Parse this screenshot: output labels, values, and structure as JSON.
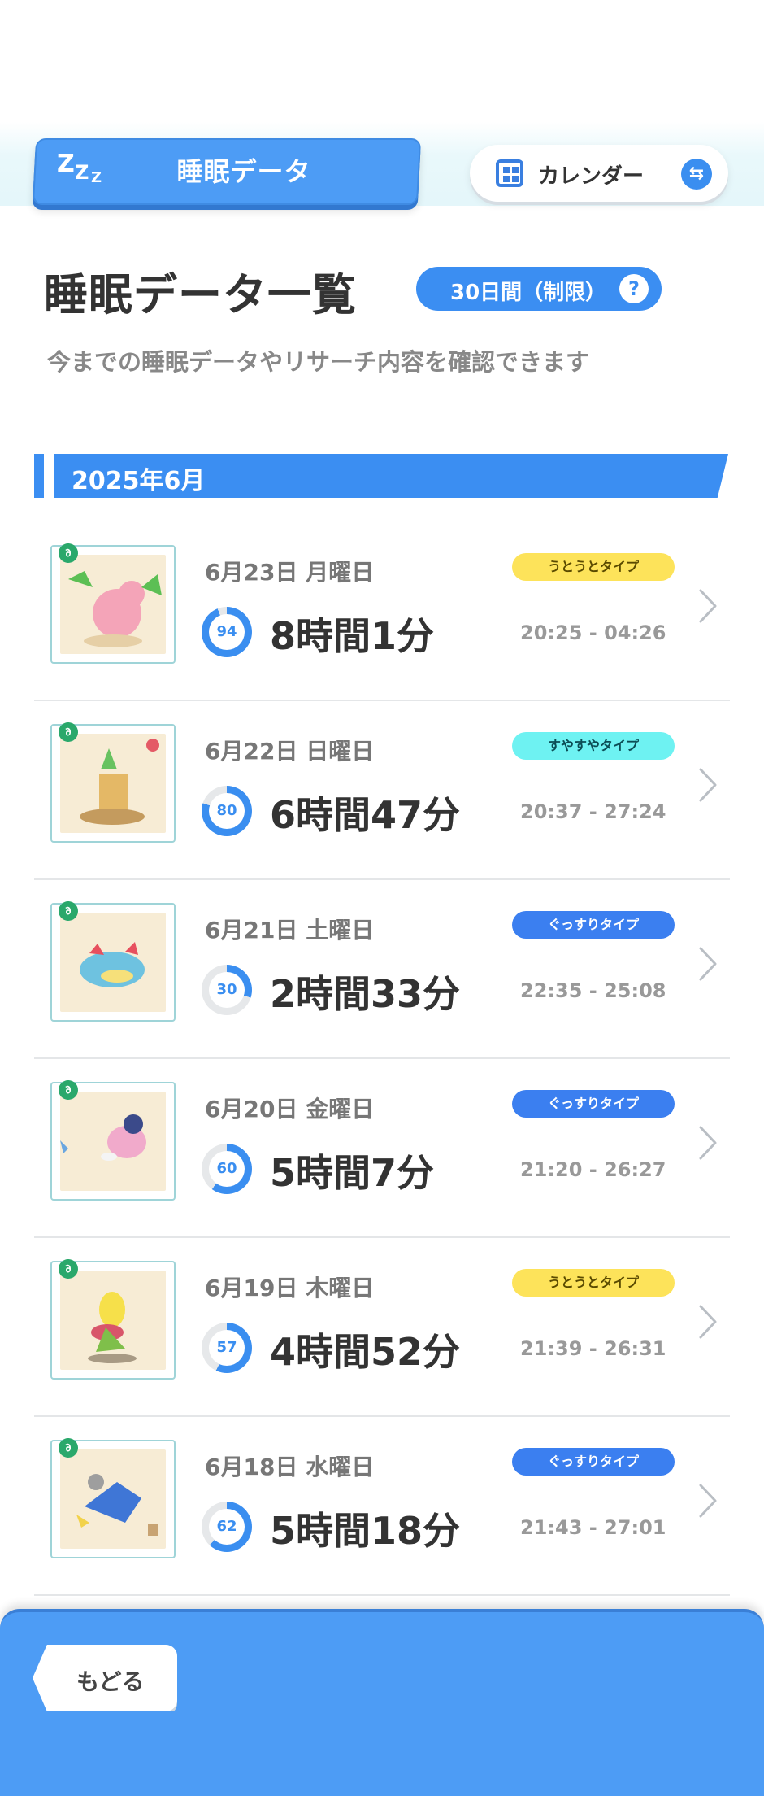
{
  "header": {
    "title": "睡眠データ",
    "calendar_label": "カレンダー"
  },
  "heading": {
    "title": "睡眠データ一覧",
    "period_label": "30日間（制限）",
    "subtitle": "今までの睡眠データやリサーチ内容を確認できます"
  },
  "month_label": "2025年6月",
  "entries": [
    {
      "date": "6月23日 月曜日",
      "type": "うとうとタイプ",
      "score": "94",
      "duration": "8時間1分",
      "range": "20:25 - 04:26"
    },
    {
      "date": "6月22日 日曜日",
      "type": "すやすやタイプ",
      "score": "80",
      "duration": "6時間47分",
      "range": "20:37 - 27:24"
    },
    {
      "date": "6月21日 土曜日",
      "type": "ぐっすりタイプ",
      "score": "30",
      "duration": "2時間33分",
      "range": "22:35 - 25:08"
    },
    {
      "date": "6月20日 金曜日",
      "type": "ぐっすりタイプ",
      "score": "60",
      "duration": "5時間7分",
      "range": "21:20 - 26:27"
    },
    {
      "date": "6月19日 木曜日",
      "type": "うとうとタイプ",
      "score": "57",
      "duration": "4時間52分",
      "range": "21:39 - 26:31"
    },
    {
      "date": "6月18日 水曜日",
      "type": "ぐっすりタイプ",
      "score": "62",
      "duration": "5時間18分",
      "range": "21:43 - 27:01"
    }
  ],
  "type_colors": {
    "うとうとタイプ": {
      "bg": "#fde35a",
      "fg": "#5a4a00"
    },
    "すやすやタイプ": {
      "bg": "#6ef2f2",
      "fg": "#0c4d55"
    },
    "ぐっすりタイプ": {
      "bg": "#3b7ff0",
      "fg": "#ffffff"
    }
  },
  "footer": {
    "back_label": "もどる"
  }
}
